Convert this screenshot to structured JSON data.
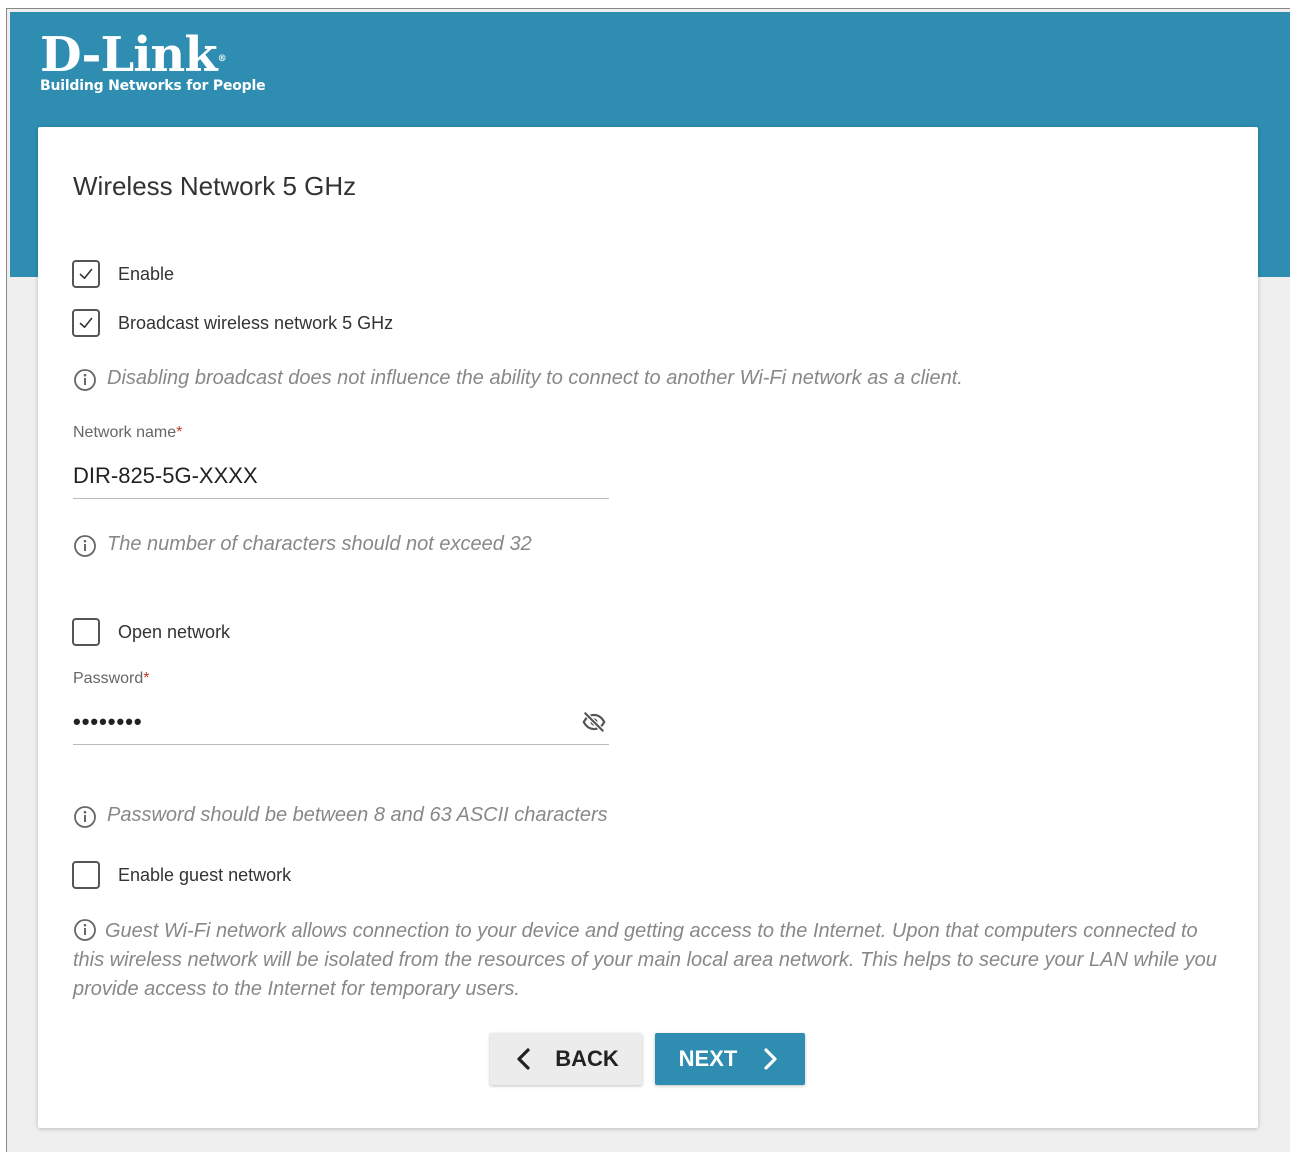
{
  "brand": {
    "logo_text": "D-Link",
    "logo_reg": "®",
    "tagline": "Building Networks for People",
    "primary_color": "#2e8db0"
  },
  "page": {
    "title": "Wireless Network 5 GHz"
  },
  "options": {
    "enable": {
      "label": "Enable",
      "checked": true
    },
    "broadcast": {
      "label": "Broadcast wireless network 5 GHz",
      "checked": true
    },
    "open_network": {
      "label": "Open network",
      "checked": false
    },
    "guest_network": {
      "label": "Enable guest network",
      "checked": false
    }
  },
  "hints": {
    "broadcast": "Disabling broadcast does not influence the ability to connect to another Wi-Fi network as a client.",
    "name_length": "The number of characters should not exceed 32",
    "password_length": "Password should be between 8 and 63 ASCII characters",
    "guest": "Guest Wi-Fi network allows connection to your device and getting access to the Internet. Upon that computers connected to this wireless network will be isolated from the resources of your main local area network. This helps to secure your LAN while you provide access to the Internet for temporary users."
  },
  "fields": {
    "network_name": {
      "label": "Network name",
      "required_mark": "*",
      "value": "DIR-825-5G-XXXX"
    },
    "password": {
      "label": "Password",
      "required_mark": "*",
      "masked_value": "••••••••",
      "toggle_icon": "eye-slash-icon"
    }
  },
  "buttons": {
    "back": "BACK",
    "next": "NEXT"
  }
}
